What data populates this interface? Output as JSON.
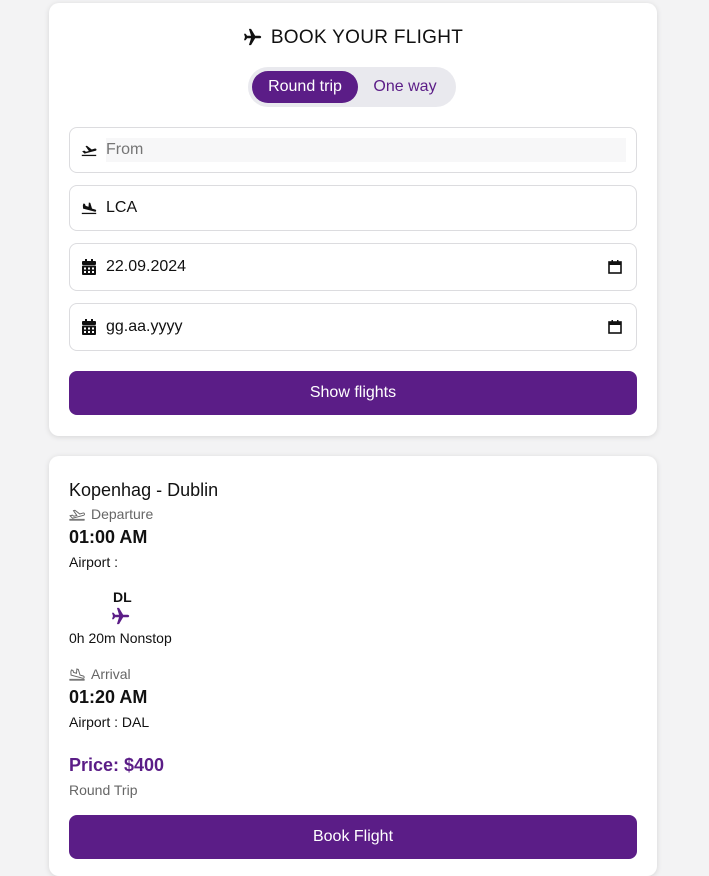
{
  "search": {
    "title": "BOOK YOUR FLIGHT",
    "trip_options": [
      "Round trip",
      "One way"
    ],
    "selected_trip": "Round trip",
    "from_placeholder": "From",
    "from_value": "",
    "to_value": "LCA",
    "departure_date": "22.09.2024",
    "return_date_placeholder": "gg.aa.yyyy",
    "submit_label": "Show flights"
  },
  "result": {
    "route": "Kopenhag - Dublin",
    "departure_label": "Departure",
    "departure_time": "01:00 AM",
    "departure_airport": "Airport :",
    "carrier": "DL",
    "duration": "0h 20m Nonstop",
    "arrival_label": "Arrival",
    "arrival_time": "01:20 AM",
    "arrival_airport": "Airport : DAL",
    "price": "Price: $400",
    "trip_type": "Round Trip",
    "book_label": "Book Flight"
  },
  "colors": {
    "accent": "#5b1d87",
    "background": "#f3f3f4"
  },
  "icons": {
    "title": "plane-icon",
    "from": "plane-departure-icon",
    "to": "plane-arrival-icon",
    "date": "calendar-icon",
    "carrier": "plane-icon"
  }
}
